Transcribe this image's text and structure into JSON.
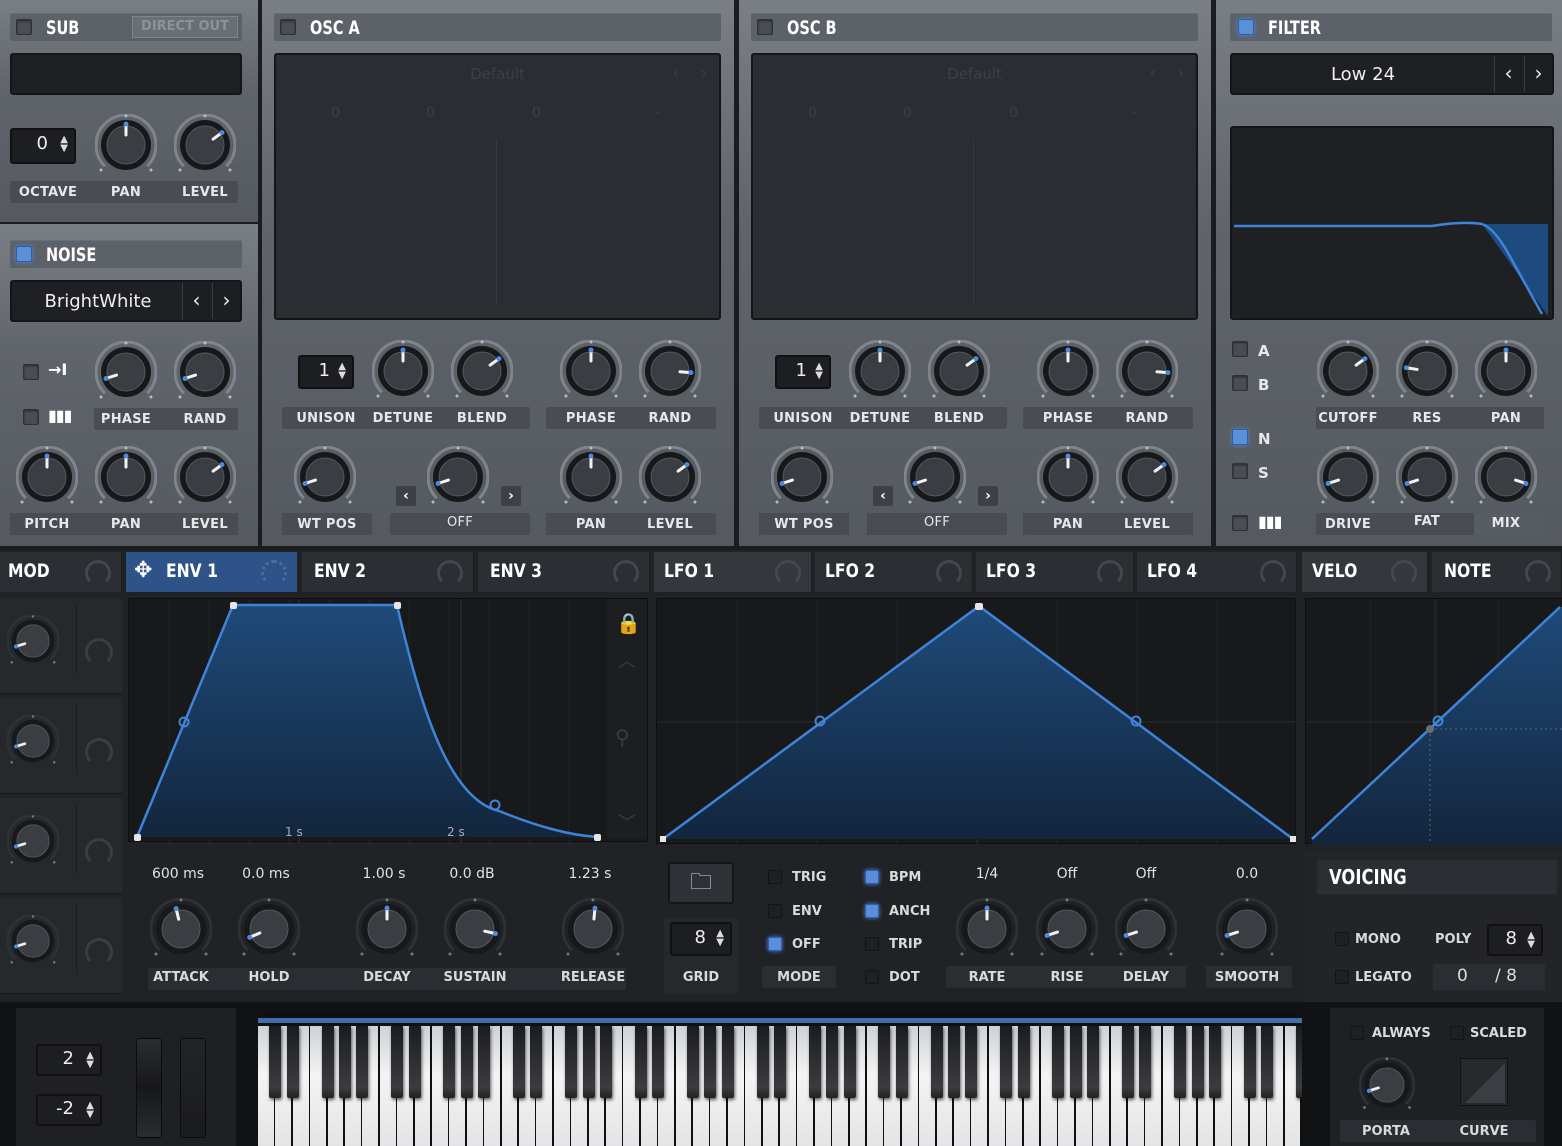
{
  "sub": {
    "title": "SUB",
    "direct_out_label": "DIRECT OUT",
    "enabled": false,
    "octave_value": "0",
    "labels": [
      "OCTAVE",
      "PAN",
      "LEVEL"
    ],
    "knobs": {
      "pan": 0.5,
      "level": 0.7
    }
  },
  "noise": {
    "title": "NOISE",
    "enabled": true,
    "preset": "BrightWhite",
    "prev_icon": "‹",
    "next_icon": "›",
    "phase_label": "PHASE",
    "rand_label": "RAND",
    "bottom_labels": [
      "PITCH",
      "PAN",
      "LEVEL"
    ],
    "knobs": {
      "phase": 0.1,
      "rand": 0.1,
      "pitch": 0.5,
      "pan": 0.5,
      "level": 0.7
    }
  },
  "osc_a": {
    "title": "OSC A",
    "enabled": false,
    "wavetable_name": "Default",
    "wavetable_values": [
      "0",
      "0",
      "0",
      "–"
    ],
    "unison_value": "1",
    "top_labels": [
      "UNISON",
      "DETUNE",
      "BLEND"
    ],
    "phase_labels": [
      "PHASE",
      "RAND"
    ],
    "wtpos_label": "WT POS",
    "warp_label": "OFF",
    "pan_labels": [
      "PAN",
      "LEVEL"
    ],
    "knobs": {
      "detune": 0.5,
      "blend": 0.7,
      "phase": 0.5,
      "rand": 0.85,
      "wt_pos": 0.1,
      "warp": 0.1,
      "pan": 0.5,
      "level": 0.7
    }
  },
  "osc_b": {
    "title": "OSC B",
    "enabled": false,
    "wavetable_name": "Default",
    "wavetable_values": [
      "0",
      "0",
      "0",
      "–"
    ],
    "unison_value": "1",
    "top_labels": [
      "UNISON",
      "DETUNE",
      "BLEND"
    ],
    "phase_labels": [
      "PHASE",
      "RAND"
    ],
    "wtpos_label": "WT POS",
    "warp_label": "OFF",
    "pan_labels": [
      "PAN",
      "LEVEL"
    ],
    "knobs": {
      "detune": 0.5,
      "blend": 0.7,
      "phase": 0.5,
      "rand": 0.85,
      "wt_pos": 0.1,
      "warp": 0.1,
      "pan": 0.5,
      "level": 0.7
    }
  },
  "filter": {
    "title": "FILTER",
    "enabled": true,
    "type": "Low 24",
    "routing": [
      {
        "label": "A",
        "on": false
      },
      {
        "label": "B",
        "on": false
      },
      {
        "label": "N",
        "on": true
      },
      {
        "label": "S",
        "on": false
      }
    ],
    "keytrack_icon": "piano-icon",
    "top_labels": [
      "CUTOFF",
      "RES",
      "PAN"
    ],
    "bottom_labels": [
      "DRIVE",
      "FAT",
      "MIX"
    ],
    "knobs": {
      "cutoff": 0.7,
      "res": 0.2,
      "pan": 0.5,
      "drive": 0.1,
      "fat": 0.1,
      "mix": 0.9
    }
  },
  "mod": {
    "title": "MOD",
    "slots": 4
  },
  "env_tabs": [
    {
      "label": "ENV 1",
      "active": true
    },
    {
      "label": "ENV 2",
      "active": false
    },
    {
      "label": "ENV 3",
      "active": false
    }
  ],
  "env1": {
    "time_markers": [
      "1 s",
      "2 s"
    ],
    "params": [
      {
        "label": "ATTACK",
        "value": "600 ms",
        "knob": 0.45
      },
      {
        "label": "HOLD",
        "value": "0.0 ms",
        "knob": 0.08
      },
      {
        "label": "DECAY",
        "value": "1.00 s",
        "knob": 0.5
      },
      {
        "label": "SUSTAIN",
        "value": "0.0 dB",
        "knob": 0.88
      },
      {
        "label": "RELEASE",
        "value": "1.23 s",
        "knob": 0.52
      }
    ]
  },
  "lfo_tabs": [
    {
      "label": "LFO 1",
      "active": true
    },
    {
      "label": "LFO 2",
      "active": false
    },
    {
      "label": "LFO 3",
      "active": false
    },
    {
      "label": "LFO 4",
      "active": false
    }
  ],
  "lfo1": {
    "grid_value": "8",
    "grid_label": "GRID",
    "mode_label": "MODE",
    "mode_options": [
      {
        "label": "TRIG",
        "on": false
      },
      {
        "label": "ENV",
        "on": false
      },
      {
        "label": "OFF",
        "on": true
      }
    ],
    "sync_options": [
      {
        "label": "BPM",
        "on": true
      },
      {
        "label": "ANCH",
        "on": true
      },
      {
        "label": "TRIP",
        "on": false
      },
      {
        "label": "DOT",
        "on": false
      }
    ],
    "params": [
      {
        "label": "RATE",
        "value": "1/4",
        "knob": 0.5
      },
      {
        "label": "RISE",
        "value": "Off",
        "knob": 0.1
      },
      {
        "label": "DELAY",
        "value": "Off",
        "knob": 0.1
      },
      {
        "label": "SMOOTH",
        "value": "0.0",
        "knob": 0.1
      }
    ]
  },
  "velo_tabs": [
    {
      "label": "VELO",
      "active": true
    },
    {
      "label": "NOTE",
      "active": false
    }
  ],
  "voicing": {
    "title": "VOICING",
    "mono_label": "MONO",
    "legato_label": "LEGATO",
    "poly_label": "POLY",
    "poly_value": "8",
    "voices_active": "0",
    "voices_total": "/ 8"
  },
  "portamento": {
    "always_label": "ALWAYS",
    "scaled_label": "SCALED",
    "porta_label": "PORTA",
    "curve_label": "CURVE",
    "knob": 0.1
  },
  "pitchbend": {
    "up_value": "2",
    "down_value": "-2"
  },
  "colors": {
    "accent": "#4a8ae0",
    "graph_fill": "#1e3a5f",
    "graph_line": "#4a8ae0"
  }
}
